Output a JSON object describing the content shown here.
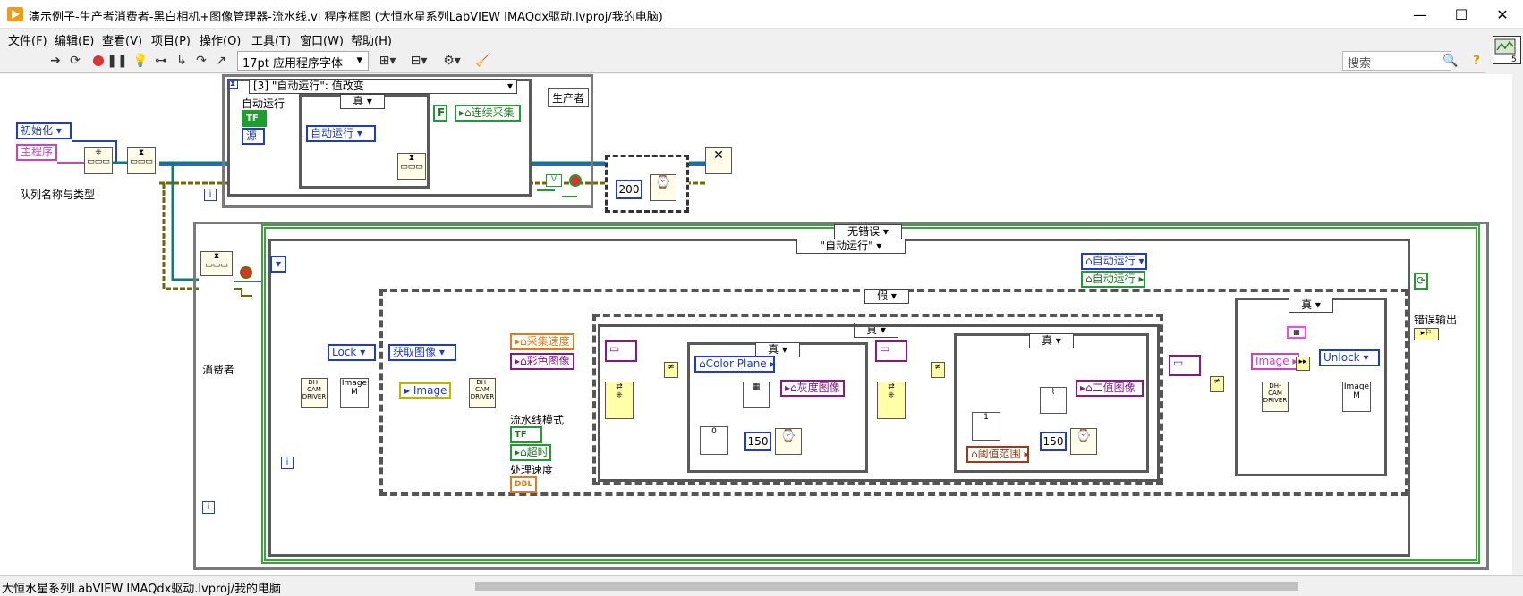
{
  "window": {
    "title": "演示例子-生产者消费者-黑白相机+图像管理器-流水线.vi 程序框图 (大恒水星系列LabVIEW IMAQdx驱动.lvproj/我的电脑)",
    "minimize": "—",
    "maximize": "☐",
    "close": "✕"
  },
  "menu": [
    "文件(F)",
    "编辑(E)",
    "查看(V)",
    "项目(P)",
    "操作(O)",
    "工具(T)",
    "窗口(W)",
    "帮助(H)"
  ],
  "toolbar": {
    "font": "17pt 应用程序字体",
    "search_placeholder": "搜索"
  },
  "status": {
    "path": "大恒水星系列LabVIEW IMAQdx驱动.lvproj/我的电脑"
  },
  "diagram": {
    "init_enum": "初始化",
    "subvi_const": "主程序",
    "queue_label": "队列名称与类型",
    "event_selector": "[3] \"自动运行\": 值改变",
    "auto_run_label": "自动运行",
    "tf": "TF",
    "source": "源",
    "true_case": "真",
    "auto_run_enum": "自动运行",
    "false_const": "F",
    "continuous": "连续采集",
    "producer": "生产者",
    "wait_200": "200",
    "no_error": "无错误",
    "auto_run_case": "\"自动运行\"",
    "consumer": "消费者",
    "auto_run_local1": "自动运行",
    "auto_run_local2": "自动运行",
    "false_case": "假",
    "lock": "Lock",
    "get_image": "获取图像",
    "image_local": "Image",
    "capture_speed": "采集速度",
    "color_image": "彩色图像",
    "pipeline_mode": "流水线模式",
    "timeout": "超时",
    "process_speed": "处理速度",
    "dbl": "DBL",
    "true_case2": "真",
    "true_case3": "真",
    "true_case4": "真",
    "color_plane": "Color Plane",
    "gray_image": "灰度图像",
    "wait_150a": "150",
    "const_0": "0",
    "threshold_range": "阈值范围",
    "binary_image": "二值图像",
    "wait_150b": "150",
    "const_1": "1",
    "image_out": "Image",
    "unlock": "Unlock",
    "error_out": "错误输出",
    "true_case5": "真",
    "image_label_a": "Image",
    "image_label_b": "Image",
    "driver_a": "DH-CAM DRIVER",
    "driver_b": "DH-CAM DRIVER",
    "driver_c": "DH-CAM DRIVER",
    "m": "M"
  }
}
